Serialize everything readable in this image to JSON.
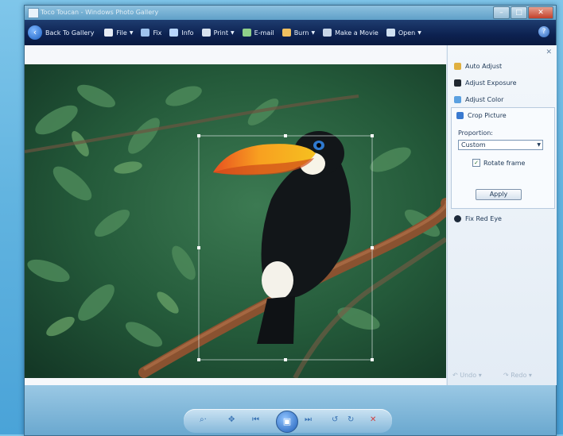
{
  "window": {
    "title": "Toco Toucan - Windows Photo Gallery"
  },
  "toolbar": {
    "back_label": "Back To Gallery",
    "items": [
      {
        "label": "File",
        "icon": "file-icon",
        "has_menu": true,
        "color": "#e6ecf5"
      },
      {
        "label": "Fix",
        "icon": "fix-icon",
        "has_menu": false,
        "color": "#9fc3ee"
      },
      {
        "label": "Info",
        "icon": "info-icon",
        "has_menu": false,
        "color": "#b8d6ff"
      },
      {
        "label": "Print",
        "icon": "print-icon",
        "has_menu": true,
        "color": "#d8e3ef"
      },
      {
        "label": "E-mail",
        "icon": "email-icon",
        "has_menu": false,
        "color": "#8fd08a"
      },
      {
        "label": "Burn",
        "icon": "burn-icon",
        "has_menu": true,
        "color": "#f0c060"
      },
      {
        "label": "Make a Movie",
        "icon": "movie-icon",
        "has_menu": false,
        "color": "#c8d6e8"
      },
      {
        "label": "Open",
        "icon": "open-icon",
        "has_menu": true,
        "color": "#cfe0f2"
      }
    ]
  },
  "panel": {
    "items": [
      {
        "label": "Auto Adjust",
        "icon": "wand-icon",
        "color": "#e0b040"
      },
      {
        "label": "Adjust Exposure",
        "icon": "exposure-icon",
        "color": "#202830"
      },
      {
        "label": "Adjust Color",
        "icon": "color-icon",
        "color": "#5aa0e0"
      }
    ],
    "crop": {
      "title": "Crop Picture",
      "proportion_label": "Proportion:",
      "proportion_value": "Custom",
      "rotate_label": "Rotate frame",
      "apply_label": "Apply"
    },
    "red_eye": "Fix Red Eye",
    "undo": "Undo",
    "redo": "Redo"
  },
  "nav": {
    "buttons": [
      {
        "name": "zoom-icon",
        "glyph": "⌕·"
      },
      {
        "name": "fit-icon",
        "glyph": "✥"
      },
      {
        "name": "previous-icon",
        "glyph": "⏮"
      },
      {
        "name": "next-icon",
        "glyph": "⏭"
      },
      {
        "name": "rotate-ccw-icon",
        "glyph": "↺"
      },
      {
        "name": "rotate-cw-icon",
        "glyph": "↻"
      },
      {
        "name": "delete-icon",
        "glyph": "✕"
      }
    ],
    "play_glyph": "▣"
  }
}
